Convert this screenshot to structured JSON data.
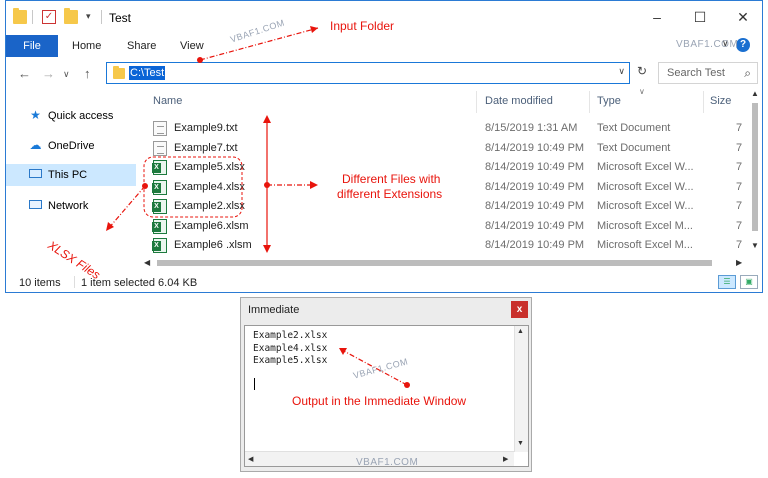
{
  "window": {
    "title": "Test",
    "tabs": {
      "file": "File",
      "home": "Home",
      "share": "Share",
      "view": "View"
    },
    "controls": {
      "minimize": "–",
      "maximize": "☐",
      "close": "✕"
    },
    "help": "?"
  },
  "address": {
    "path": "C:\\Test",
    "search_placeholder": "Search Test"
  },
  "nav_pane": [
    {
      "label": "Quick access",
      "icon": "star-icon"
    },
    {
      "label": "OneDrive",
      "icon": "cloud-icon"
    },
    {
      "label": "This PC",
      "icon": "computer-icon",
      "selected": true
    },
    {
      "label": "Network",
      "icon": "network-icon"
    }
  ],
  "columns": {
    "name": "Name",
    "date": "Date modified",
    "type": "Type",
    "size": "Size"
  },
  "files": [
    {
      "name": "Example9.txt",
      "date": "8/15/2019 1:31 AM",
      "type": "Text Document",
      "size": "7",
      "kind": "txt"
    },
    {
      "name": "Example7.txt",
      "date": "8/14/2019 10:49 PM",
      "type": "Text Document",
      "size": "7",
      "kind": "txt"
    },
    {
      "name": "Example5.xlsx",
      "date": "8/14/2019 10:49 PM",
      "type": "Microsoft Excel W...",
      "size": "7",
      "kind": "xl"
    },
    {
      "name": "Example4.xlsx",
      "date": "8/14/2019 10:49 PM",
      "type": "Microsoft Excel W...",
      "size": "7",
      "kind": "xl"
    },
    {
      "name": "Example2.xlsx",
      "date": "8/14/2019 10:49 PM",
      "type": "Microsoft Excel W...",
      "size": "7",
      "kind": "xl"
    },
    {
      "name": "Example6.xlsm",
      "date": "8/14/2019 10:49 PM",
      "type": "Microsoft Excel M...",
      "size": "7",
      "kind": "xl"
    },
    {
      "name": "Example6 .xlsm",
      "date": "8/14/2019 10:49 PM",
      "type": "Microsoft Excel M...",
      "size": "7",
      "kind": "xl"
    }
  ],
  "status": {
    "count": "10 items",
    "selection": "1 item selected  6.04 KB"
  },
  "immediate": {
    "title": "Immediate",
    "close": "x",
    "lines": [
      "Example2.xlsx",
      "Example4.xlsx",
      "Example5.xlsx"
    ]
  },
  "annotations": {
    "input_folder": "Input Folder",
    "different_files_1": "Different Files with",
    "different_files_2": "different  Extensions",
    "xlsx_files": "XLSX Files",
    "output": "Output in the Immediate Window",
    "watermark": "VBAF1.COM"
  },
  "colors": {
    "annotation": "#e8140c",
    "file_tab": "#1a64c8",
    "selection": "#cce8ff"
  }
}
